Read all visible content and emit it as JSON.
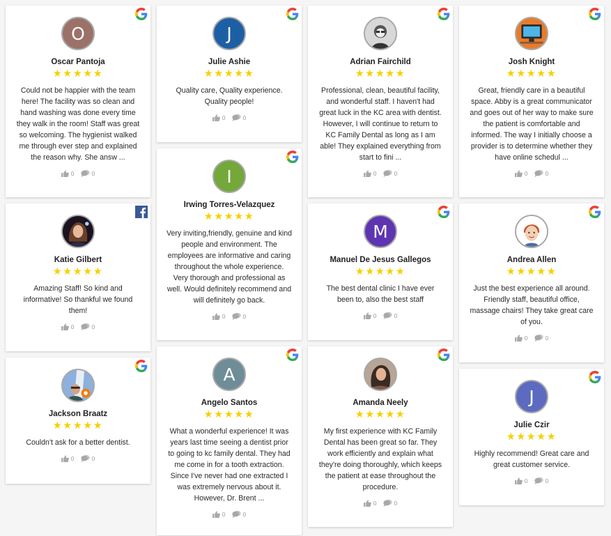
{
  "colors": {
    "star": "#f7d000",
    "google_blue": "#4285F4",
    "facebook": "#3b5998"
  },
  "reviews": [
    {
      "name": "Oscar Pantoja",
      "source": "google",
      "initial": "O",
      "avatar_color": "#9b7168",
      "stars": "★★★★★",
      "rating": 5,
      "text": "Could not be happier with the team here! The facility was so clean and hand washing was done every time they walk in the room! Staff was great so welcoming. The hygienist walked me through ever step and explained the reason why. She answ ...",
      "likes": "0",
      "comments": "0"
    },
    {
      "name": "Julie Ashie",
      "source": "google",
      "initial": "J",
      "avatar_color": "#1d5fa5",
      "stars": "★★★★★",
      "rating": 5,
      "text": "Quality care, Quality experience. Quality people!",
      "likes": "0",
      "comments": "0"
    },
    {
      "name": "Adrian Fairchild",
      "source": "google",
      "initial": "",
      "avatar_color": "#cfcfcf",
      "stars": "★★★★★",
      "rating": 5,
      "text": "Professional, clean, beautiful facility, and wonderful staff. I haven't had great luck in the KC area with dentist. However, I will continue to return to KC Family Dental as long as I am able! They explained everything from start to fini ...",
      "likes": "0",
      "comments": "0"
    },
    {
      "name": "Josh Knight",
      "source": "google",
      "initial": "",
      "avatar_color": "#e4792a",
      "stars": "★★★★★",
      "rating": 5,
      "text": "Great, friendly care in a beautiful space. Abby is a great communicator and goes out of her way to make sure the patient is comfortable and informed. The way I initially choose a provider is to determine whether they have online schedul ...",
      "likes": "0",
      "comments": "0"
    },
    {
      "name": "Katie Gilbert",
      "source": "facebook",
      "initial": "",
      "avatar_color": "#3a2a3a",
      "stars": "★★★★★",
      "rating": 5,
      "text": "Amazing Staff! So kind and informative! So thankful we found them!",
      "likes": "0",
      "comments": "0"
    },
    {
      "name": "Irwing Torres-Velazquez",
      "source": "google",
      "initial": "I",
      "avatar_color": "#74a83a",
      "stars": "★★★★★",
      "rating": 5,
      "text": "Very inviting,friendly, genuine and kind people and environment. The employees are informative and caring throughout the whole experience. Very thorough and professional as well. Would definitely recommend and will definitely go back.",
      "likes": "0",
      "comments": "0"
    },
    {
      "name": "Manuel De Jesus Gallegos",
      "source": "google",
      "initial": "M",
      "avatar_color": "#5e35b1",
      "stars": "★★★★★",
      "rating": 5,
      "text": "The best dental clinic I have ever been to, also the best staff",
      "likes": "0",
      "comments": "0"
    },
    {
      "name": "Andrea Allen",
      "source": "google",
      "initial": "",
      "avatar_color": "#ffffff",
      "stars": "★★★★★",
      "rating": 5,
      "text": "Just the best experience all around. Friendly staff, beautiful office, massage chairs! They take great care of you.",
      "likes": "0",
      "comments": "0"
    },
    {
      "name": "Jackson Braatz",
      "source": "google",
      "initial": "",
      "avatar_color": "#7f9fc9",
      "stars": "★★★★★",
      "rating": 5,
      "text": "Couldn't ask for a better dentist.",
      "likes": "0",
      "comments": "0"
    },
    {
      "name": "Angelo Santos",
      "source": "google",
      "initial": "A",
      "avatar_color": "#6e8d98",
      "stars": "★★★★★",
      "rating": 5,
      "text": "What a wonderful experience! It was years last time seeing a dentist prior to going to kc family dental. They had me come in for a tooth extraction. Since I've never had one extracted I was extremely nervous about it. However, Dr. Brent ...",
      "likes": "0",
      "comments": "0"
    },
    {
      "name": "Amanda Neely",
      "source": "google",
      "initial": "",
      "avatar_color": "#b28a6e",
      "stars": "★★★★★",
      "rating": 5,
      "text": "My first experience with KC Family Dental has been great so far. They work efficiently and explain what they're doing thoroughly, which keeps the patient at ease throughout the procedure.",
      "likes": "0",
      "comments": "0"
    },
    {
      "name": "Julie Czir",
      "source": "google",
      "initial": "J",
      "avatar_color": "#5c6bc0",
      "stars": "★★★★★",
      "rating": 5,
      "text": "Highly recommend! Great care and great customer service.",
      "likes": "0",
      "comments": "0"
    }
  ]
}
